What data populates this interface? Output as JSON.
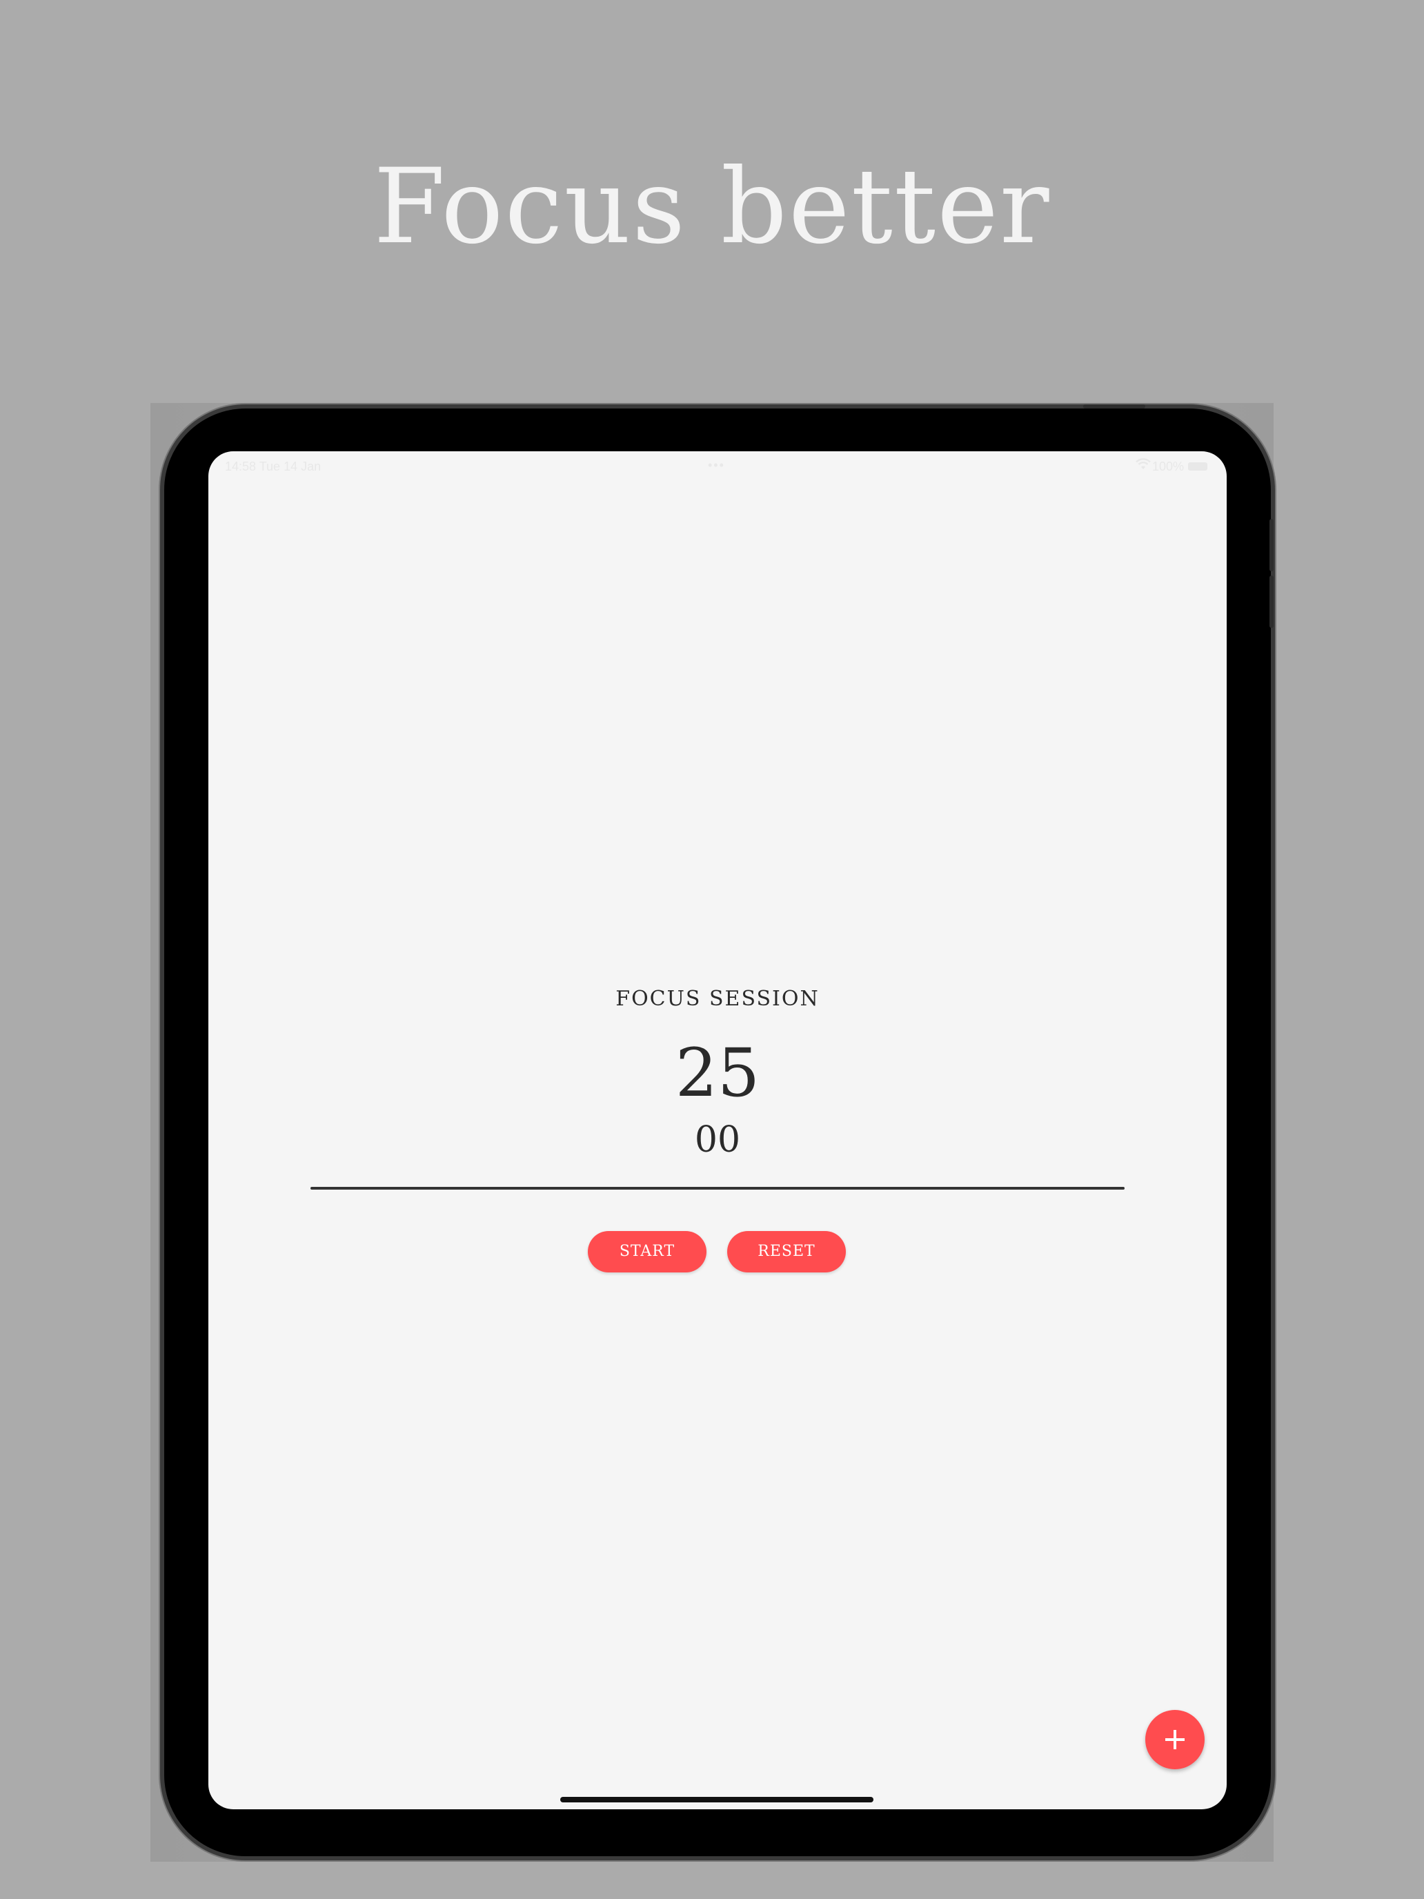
{
  "headline": "Focus better",
  "status_bar": {
    "time": "14:58 Tue 14 Jan",
    "dots": "•••",
    "battery_text": "100%"
  },
  "timer": {
    "title": "FOCUS SESSION",
    "minutes": "25",
    "seconds": "00",
    "progress": 1.0
  },
  "buttons": {
    "start_label": "START",
    "reset_label": "RESET"
  },
  "fab": {
    "icon": "plus-icon"
  },
  "colors": {
    "background": "#ababab",
    "screen": "#f5f5f5",
    "accent": "#ff4c4f",
    "text": "#2a2a2a"
  }
}
